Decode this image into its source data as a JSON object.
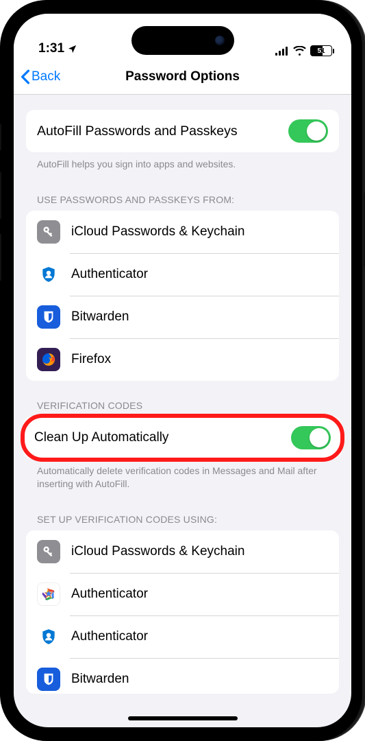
{
  "status": {
    "time": "1:31",
    "battery_pct": "51"
  },
  "nav": {
    "back": "Back",
    "title": "Password Options"
  },
  "autofill": {
    "label": "AutoFill Passwords and Passkeys",
    "footer": "AutoFill helps you sign into apps and websites."
  },
  "providers": {
    "header": "USE PASSWORDS AND PASSKEYS FROM:",
    "items": [
      {
        "label": "iCloud Passwords & Keychain",
        "icon": "key"
      },
      {
        "label": "Authenticator",
        "icon": "ms-auth"
      },
      {
        "label": "Bitwarden",
        "icon": "bitwarden"
      },
      {
        "label": "Firefox",
        "icon": "firefox"
      }
    ]
  },
  "verification": {
    "header": "VERIFICATION CODES",
    "cleanup_label": "Clean Up Automatically",
    "footer": "Automatically delete verification codes in Messages and Mail after inserting with AutoFill."
  },
  "setup": {
    "header": "SET UP VERIFICATION CODES USING:",
    "items": [
      {
        "label": "iCloud Passwords & Keychain",
        "icon": "key"
      },
      {
        "label": "Authenticator",
        "icon": "google-auth"
      },
      {
        "label": "Authenticator",
        "icon": "ms-auth"
      },
      {
        "label": "Bitwarden",
        "icon": "bitwarden"
      }
    ]
  },
  "colors": {
    "toggle_on": "#34c759",
    "accent_blue": "#007aff",
    "highlight_red": "#ff1a1a"
  }
}
